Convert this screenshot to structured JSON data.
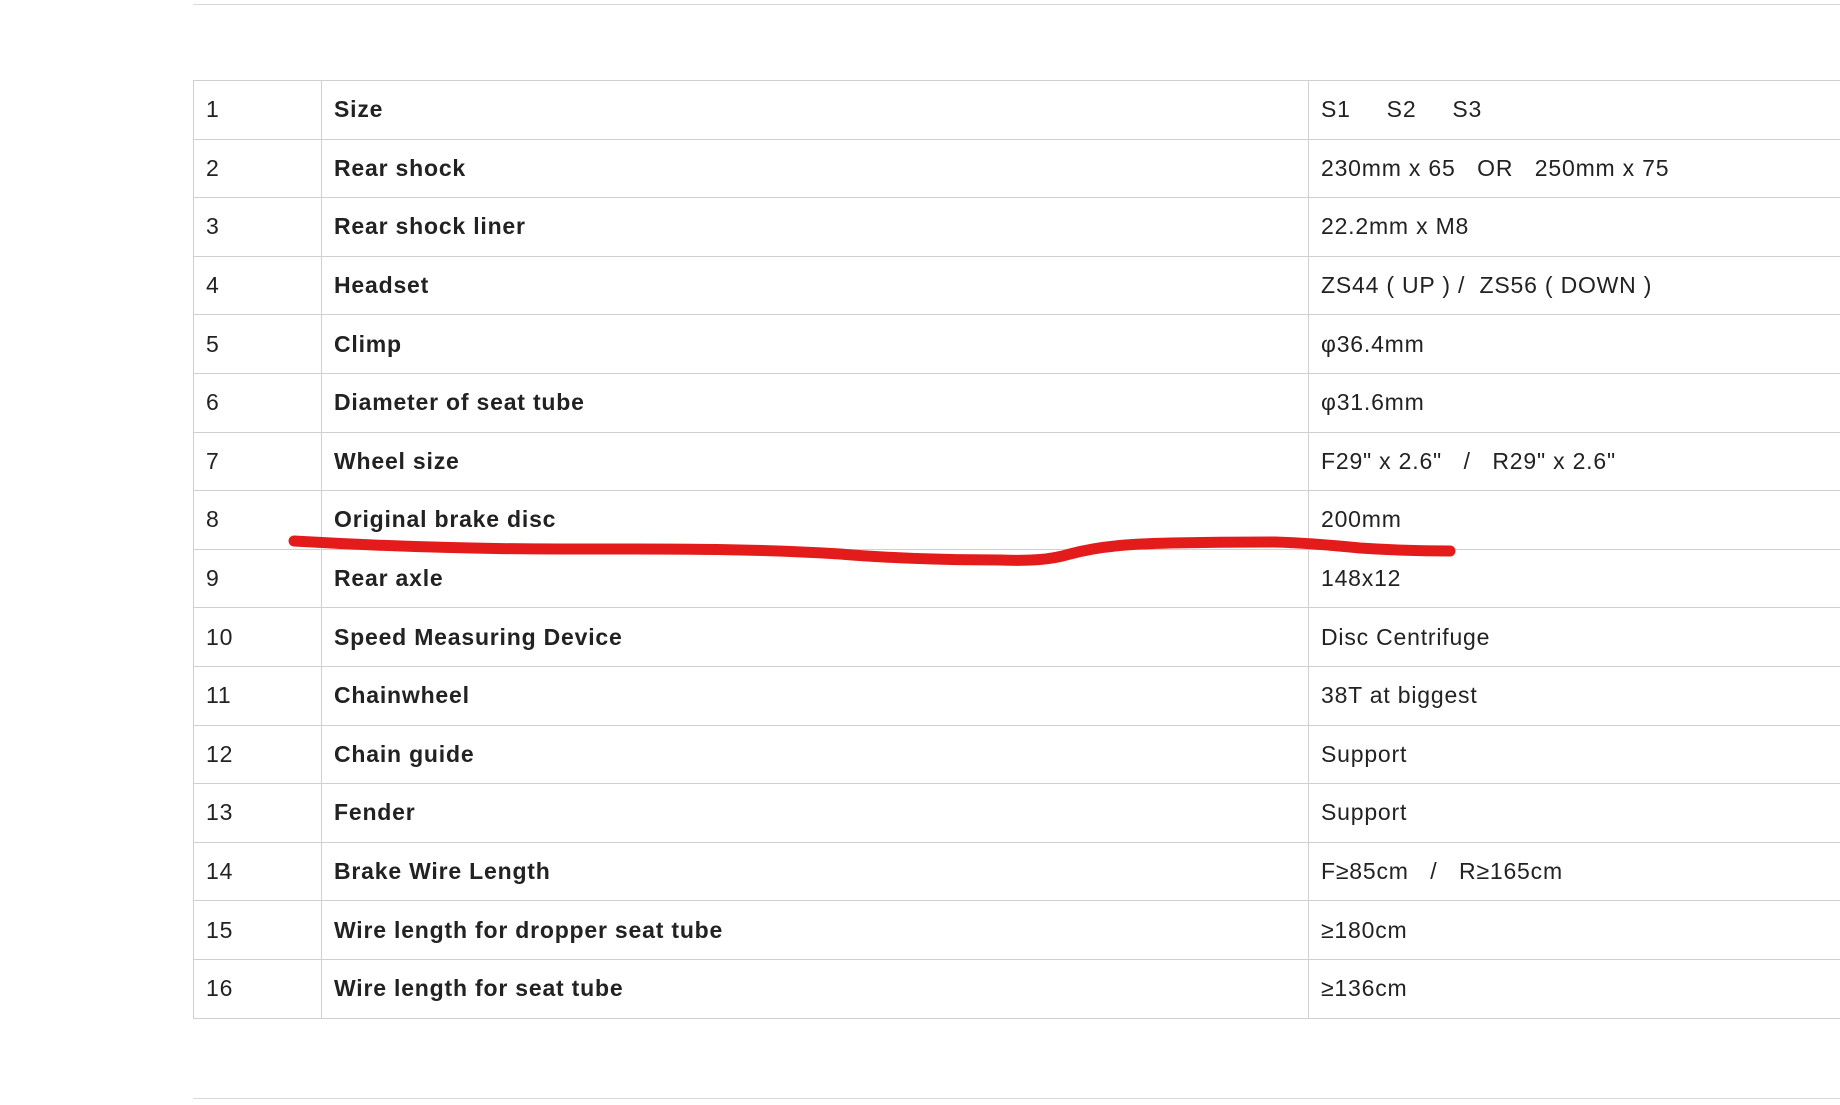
{
  "spec_table": {
    "rows": [
      {
        "num": "1",
        "name": "Size",
        "value": "S1     S2     S3"
      },
      {
        "num": "2",
        "name": "Rear shock",
        "value": "230mm x 65   OR   250mm x 75"
      },
      {
        "num": "3",
        "name": "Rear shock liner",
        "value": "22.2mm x M8"
      },
      {
        "num": "4",
        "name": "Headset",
        "value": "ZS44 ( UP ) /  ZS56 ( DOWN )"
      },
      {
        "num": "5",
        "name": "Climp",
        "value": "φ36.4mm"
      },
      {
        "num": "6",
        "name": "Diameter of seat tube",
        "value": "φ31.6mm"
      },
      {
        "num": "7",
        "name": "Wheel size",
        "value": "F29\" x 2.6\"   /   R29\" x 2.6\""
      },
      {
        "num": "8",
        "name": "Original brake disc",
        "value": "200mm"
      },
      {
        "num": "9",
        "name": "Rear axle",
        "value": "148x12"
      },
      {
        "num": "10",
        "name": "Speed Measuring Device",
        "value": "Disc Centrifuge"
      },
      {
        "num": "11",
        "name": "Chainwheel",
        "value": "38T at biggest"
      },
      {
        "num": "12",
        "name": "Chain guide",
        "value": "Support"
      },
      {
        "num": "13",
        "name": "Fender",
        "value": "Support"
      },
      {
        "num": "14",
        "name": "Brake Wire Length",
        "value": "F≥85cm   /   R≥165cm"
      },
      {
        "num": "15",
        "name": "Wire length for dropper seat tube",
        "value": "≥180cm"
      },
      {
        "num": "16",
        "name": "Wire length for seat tube",
        "value": "≥136cm"
      }
    ]
  },
  "annotation": {
    "color": "#e31b1b",
    "kind": "hand-drawn underline"
  }
}
